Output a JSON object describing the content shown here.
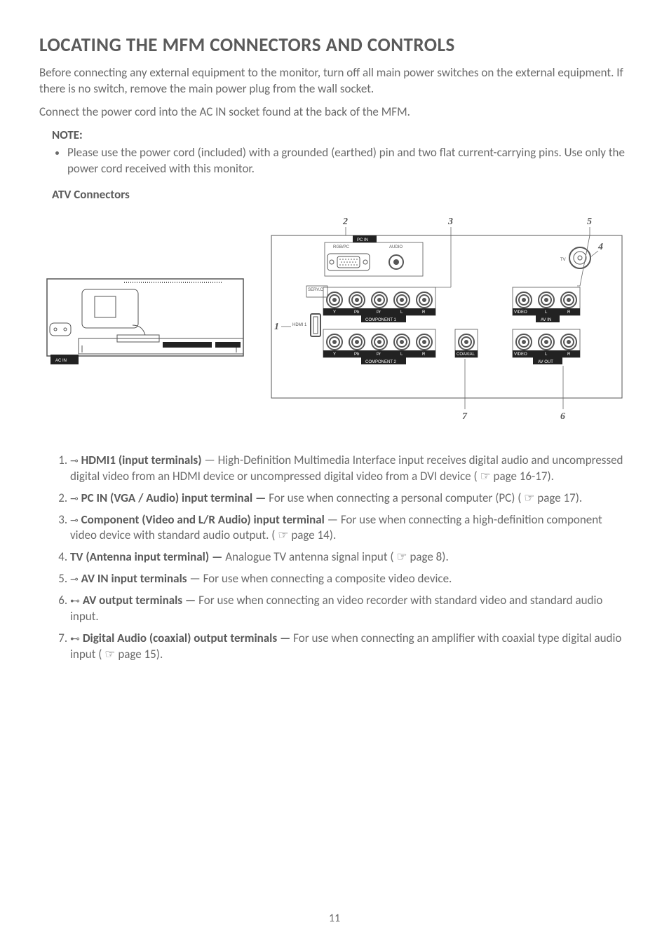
{
  "title": "LOCATING THE MFM CONNECTORS AND CONTROLS",
  "intro1": "Before connecting any external equipment to the monitor, turn off all main power switches on the external equipment. If there is no switch, remove the main power plug from the wall socket.",
  "intro2": "Connect the power cord into the AC IN socket found at the back of the MFM.",
  "note": {
    "heading": "NOTE:",
    "bullet": "Please use the power cord (included) with a grounded (earthed) pin and two flat current-carrying pins. Use only the power cord received with this monitor."
  },
  "subheading": "ATV Connectors",
  "diagram": {
    "callouts": {
      "c1": "1",
      "c2": "2",
      "c3": "3",
      "c4": "4",
      "c5": "5",
      "c6": "6",
      "c7": "7"
    },
    "labels": {
      "acin": "AC IN",
      "hdmi1": "HDMI 1",
      "servc": "SERV.C",
      "pcin": "PC IN",
      "rgbpc": "RGB/PC",
      "audio": "AUDIO",
      "y": "Y",
      "pb": "Pb",
      "pr": "Pr",
      "l": "L",
      "r": "R",
      "component1": "COMPONENT 1",
      "component2": "COMPONENT 2",
      "coaxial": "COAXIAL",
      "tv": "TV",
      "video": "VIDEO",
      "avin": "AV IN",
      "avout": "AV OUT"
    }
  },
  "list": {
    "i1a": "HDMI1 (input terminals)",
    "i1b": " — High-Definition Multimedia Interface input receives digital audio and uncompressed digital video from an HDMI device or uncompressed digital video from a DVI device ( ☞ page 16-17).",
    "i2a": "PC IN (VGA / Audio) input terminal —",
    "i2b": " For use when connecting a personal computer (PC) ( ☞ page 17).",
    "i3a": "Component (Video and L/R Audio) input terminal",
    "i3b": " — For use when connecting a high-definition component video device with standard audio output. ( ☞ page 14).",
    "i4a": "TV (Antenna input terminal) —",
    "i4b": " Analogue TV antenna signal input ( ☞ page 8).",
    "i5a": "AV IN input terminals",
    "i5b": " — For use when connecting a composite video device.",
    "i6a": "AV output terminals —",
    "i6b": " For use when connecting an video recorder with standard video and standard audio input.",
    "i7a": "Digital Audio (coaxial) output terminals —",
    "i7b": " For use when connecting an amplifier with coaxial type digital audio input ( ☞ page 15)."
  },
  "page_number": "11"
}
